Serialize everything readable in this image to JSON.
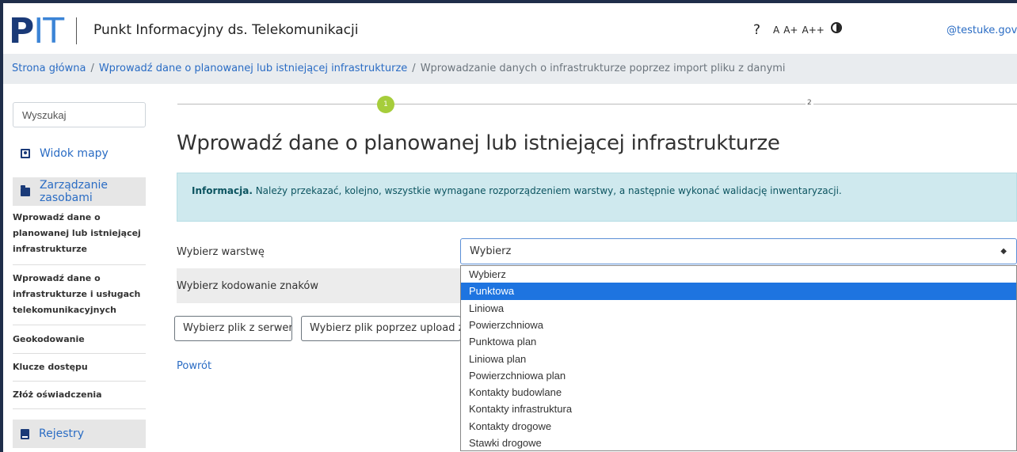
{
  "header": {
    "logo_p": "P",
    "logo_it": "IT",
    "app_title": "Punkt Informacyjny ds. Telekomunikacji",
    "help": "?",
    "font_sizes": [
      "A",
      "A+",
      "A++"
    ],
    "user": "@testuke.gov.pl"
  },
  "breadcrumb": {
    "home": "Strona główna",
    "parent": "Wprowadź dane o planowanej lub istniejącej infrastrukturze",
    "current": "Wprowadzanie danych o infrastrukturze poprzez import pliku z danymi",
    "separator": "/"
  },
  "sidebar": {
    "search_placeholder": "Wyszukaj",
    "map_view": "Widok mapy",
    "section_resources": "Zarządzanie zasobami",
    "items": [
      {
        "line1": "Wprowadź dane o",
        "line2": "planowanej lub istniejącej",
        "line3": "infrastrukturze"
      },
      {
        "line1": "Wprowadź dane o",
        "line2": "infrastrukturze i usługach",
        "line3": "telekomunikacyjnych"
      },
      {
        "line1": "Geokodowanie"
      },
      {
        "line1": "Klucze dostępu"
      },
      {
        "line1": "Złóż oświadczenia"
      }
    ],
    "section_registers": "Rejestry"
  },
  "stepper": {
    "step1": "1",
    "step2": "2"
  },
  "main": {
    "title": "Wprowadź dane o planowanej lub istniejącej infrastrukturze",
    "info_bold": "Informacja.",
    "info_text": " Należy przekazać, kolejno, wszystkie wymagane rozporządzeniem warstwy, a następnie wykonać walidację inwentaryzacji.",
    "layer_label": "Wybierz warstwę",
    "encoding_label": "Wybierz kodowanie znaków",
    "select_value": "Wybierz",
    "select_arrows": "◆",
    "btn_server": "Wybierz plik z serwera",
    "btn_upload": "Wybierz plik poprzez upload z dysku",
    "back": "Powrót"
  },
  "dropdown": {
    "options": [
      "Wybierz",
      "Punktowa",
      "Liniowa",
      "Powierzchniowa",
      "Punktowa plan",
      "Liniowa plan",
      "Powierzchniowa plan",
      "Kontakty budowlane",
      "Kontakty infrastruktura",
      "Kontakty drogowe",
      "Stawki drogowe"
    ],
    "selected_index": 1
  },
  "colors": {
    "brand_dark": "#1a3a78",
    "brand_light": "#3b84d6",
    "link": "#2a6cc4",
    "step_active": "#a6cd3b",
    "info_bg": "#cfe9ee",
    "selected_option": "#1e74e0"
  },
  "icons": {
    "map": "map-icon",
    "folder": "folder-icon",
    "book": "book-icon",
    "contrast": "contrast-icon",
    "caret": "caret-down-icon"
  }
}
